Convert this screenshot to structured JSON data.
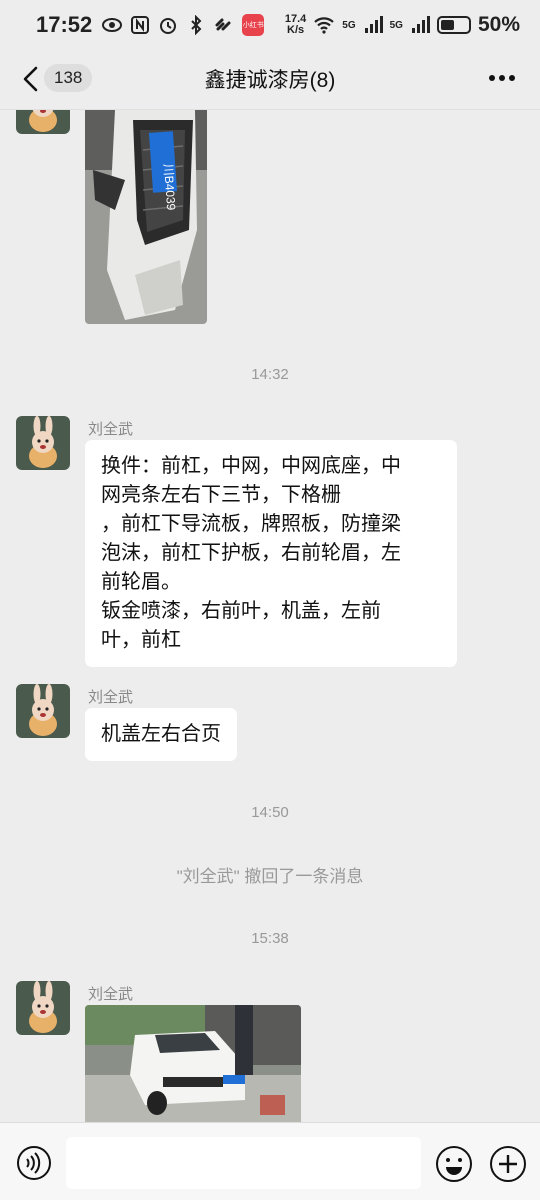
{
  "status_bar": {
    "time": "17:52",
    "app_icon_label": "小红书",
    "net_speed_value": "17.4",
    "net_speed_unit": "K/s",
    "signal_1": "5G",
    "signal_2": "5G",
    "battery": "50%"
  },
  "header": {
    "back_count": "138",
    "title": "鑫捷诚漆房(8)"
  },
  "messages": [
    {
      "type": "image",
      "desc_icon": "car-front-bumper-photo",
      "plate": "川B4039"
    },
    {
      "type": "timestamp",
      "text": "14:32"
    },
    {
      "type": "text",
      "sender": "刘全武",
      "lines": [
        "换件：前杠，中网，中网底座，中",
        "网亮条左右下三节，下格栅",
        "，前杠下导流板，牌照板，防撞梁",
        "泡沫，前杠下护板，右前轮眉，左",
        "前轮眉。",
        "钣金喷漆，右前叶，机盖，左前",
        "叶，前杠"
      ]
    },
    {
      "type": "text",
      "sender": "刘全武",
      "lines": [
        "机盖左右合页"
      ]
    },
    {
      "type": "timestamp",
      "text": "14:50"
    },
    {
      "type": "system",
      "text": "\"刘全武\" 撤回了一条消息"
    },
    {
      "type": "timestamp",
      "text": "15:38"
    },
    {
      "type": "image",
      "sender": "刘全武",
      "desc_icon": "white-car-in-garage-photo"
    }
  ],
  "input_bar": {
    "placeholder": ""
  },
  "colors": {
    "background": "#ededed",
    "bubble": "#ffffff",
    "meta_text": "#999999"
  }
}
